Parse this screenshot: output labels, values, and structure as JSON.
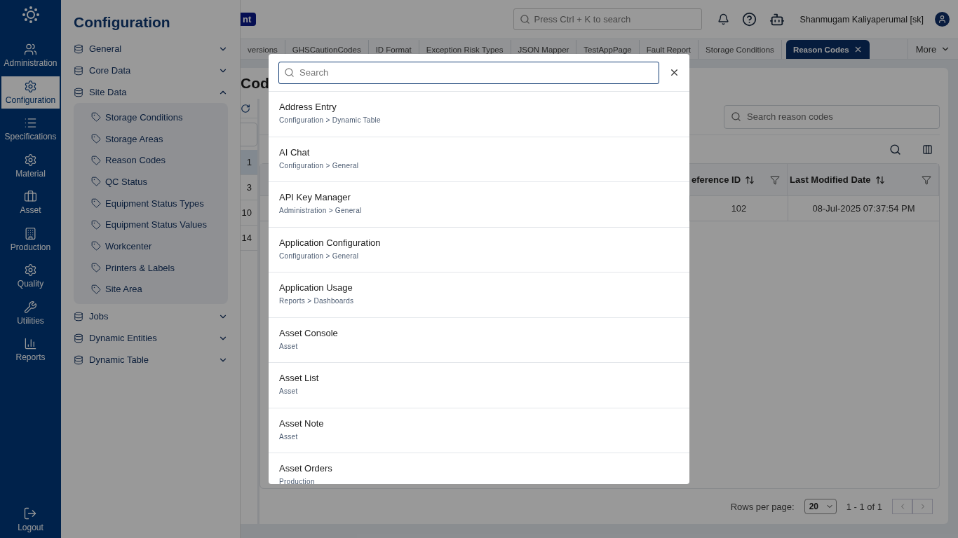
{
  "rail": {
    "items": [
      {
        "label": "Administration",
        "selected": false
      },
      {
        "label": "Configuration",
        "selected": true
      },
      {
        "label": "Specifications",
        "selected": false
      },
      {
        "label": "Material",
        "selected": false
      },
      {
        "label": "Asset",
        "selected": false
      },
      {
        "label": "Production",
        "selected": false
      },
      {
        "label": "Quality",
        "selected": false
      },
      {
        "label": "Utilities",
        "selected": false
      },
      {
        "label": "Reports",
        "selected": false
      }
    ],
    "logout": "Logout"
  },
  "panel": {
    "title": "Configuration",
    "groups": [
      {
        "label": "General",
        "expanded": false
      },
      {
        "label": "Core Data",
        "expanded": false
      },
      {
        "label": "Site Data",
        "expanded": true,
        "children": [
          {
            "label": "Storage Conditions"
          },
          {
            "label": "Storage Areas"
          },
          {
            "label": "Reason Codes"
          },
          {
            "label": "QC Status"
          },
          {
            "label": "Equipment Status Types"
          },
          {
            "label": "Equipment Status Values"
          },
          {
            "label": "Workcenter"
          },
          {
            "label": "Printers & Labels"
          },
          {
            "label": "Site Area"
          }
        ]
      },
      {
        "label": "Jobs",
        "expanded": false
      },
      {
        "label": "Dynamic Entities",
        "expanded": false
      },
      {
        "label": "Dynamic Table",
        "expanded": false
      }
    ]
  },
  "header": {
    "badge": "nt",
    "search_placeholder": "Press Ctrl + K to search",
    "user": "Shanmugam Kaliyaperumal [sk]"
  },
  "tabs": [
    {
      "label": "versions",
      "selected": false
    },
    {
      "label": "GHSCautionCodes",
      "selected": false
    },
    {
      "label": "ID Format",
      "selected": false
    },
    {
      "label": "Exception Risk Types",
      "selected": false
    },
    {
      "label": "JSON Mapper",
      "selected": false
    },
    {
      "label": "TestAppPage",
      "selected": false
    },
    {
      "label": "Fault Report",
      "selected": false
    },
    {
      "label": "Storage Conditions",
      "selected": false
    },
    {
      "label": "Reason Codes",
      "selected": true
    }
  ],
  "more": "More",
  "page": {
    "title": "Cod",
    "side_numbers": [
      {
        "label": "1",
        "selected": true
      },
      {
        "label": "3",
        "selected": false
      },
      {
        "label": "10",
        "selected": false
      },
      {
        "label": "14",
        "selected": false
      }
    ],
    "search_placeholder": "Search reason codes",
    "columns": [
      "eference ID",
      "Last Modified Date"
    ],
    "rows": [
      [
        "102",
        "08-Jul-2025 07:37:54 PM"
      ]
    ],
    "rows_per_page_label": "Rows per page:",
    "rows_per_page": "20",
    "range": "1 - 1 of 1"
  },
  "dialog": {
    "search_placeholder": "Search",
    "results": [
      {
        "title": "Address Entry",
        "path": "Configuration > Dynamic Table"
      },
      {
        "title": "AI Chat",
        "path": "Configuration > General"
      },
      {
        "title": "API Key Manager",
        "path": "Administration > General"
      },
      {
        "title": "Application Configuration",
        "path": "Configuration > General"
      },
      {
        "title": "Application Usage",
        "path": "Reports > Dashboards"
      },
      {
        "title": "Asset Console",
        "path": "Asset"
      },
      {
        "title": "Asset List",
        "path": "Asset"
      },
      {
        "title": "Asset Note",
        "path": "Asset"
      },
      {
        "title": "Asset Orders",
        "path": "Production"
      }
    ]
  }
}
